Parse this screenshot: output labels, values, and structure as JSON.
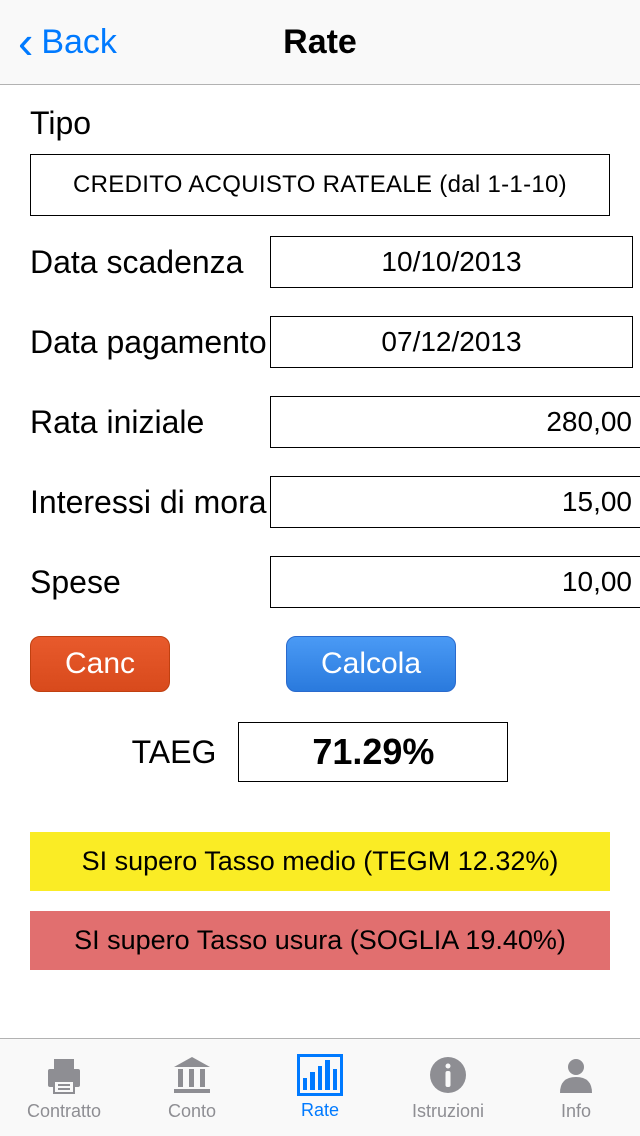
{
  "header": {
    "back": "Back",
    "title": "Rate"
  },
  "form": {
    "tipo_label": "Tipo",
    "tipo_value": "CREDITO ACQUISTO RATEALE (dal 1-1-10)",
    "data_scadenza_label": "Data scadenza",
    "data_scadenza_value": "10/10/2013",
    "data_pagamento_label": "Data pagamento",
    "data_pagamento_value": "07/12/2013",
    "rata_iniziale_label": "Rata iniziale",
    "rata_iniziale_value": "280,00",
    "interessi_mora_label": "Interessi di mora",
    "interessi_mora_value": "15,00",
    "spese_label": "Spese",
    "spese_value": "10,00"
  },
  "buttons": {
    "canc": "Canc",
    "calcola": "Calcola"
  },
  "result": {
    "taeg_label": "TAEG",
    "taeg_value": "71.29%"
  },
  "alerts": {
    "tegm": "SI supero Tasso medio (TEGM 12.32%)",
    "soglia": "SI supero Tasso usura (SOGLIA 19.40%)"
  },
  "tabs": {
    "contratto": "Contratto",
    "conto": "Conto",
    "rate": "Rate",
    "istruzioni": "Istruzioni",
    "info": "Info"
  }
}
